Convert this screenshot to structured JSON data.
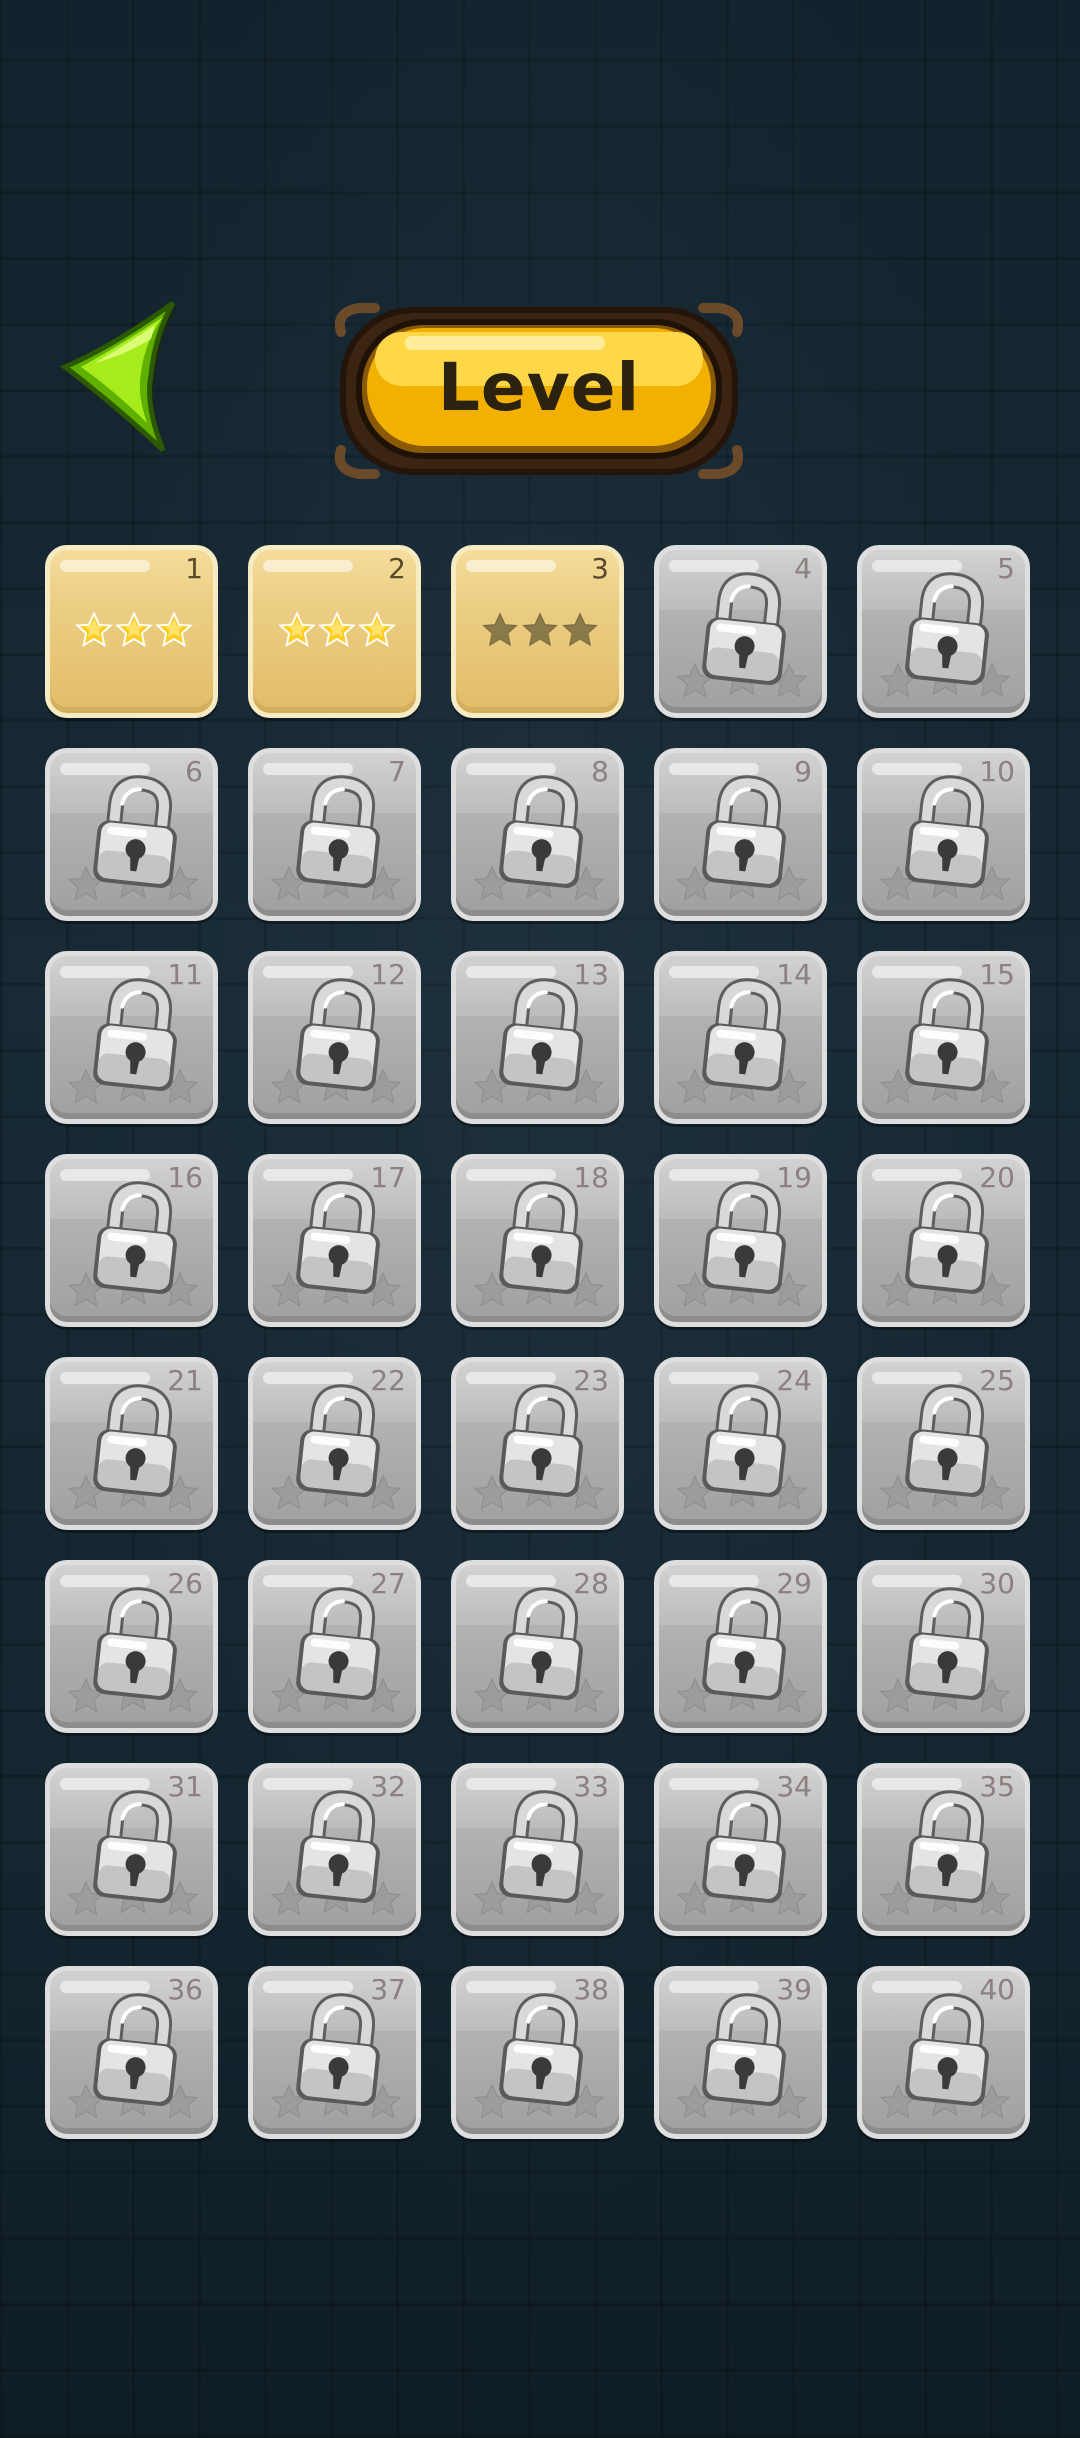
{
  "header": {
    "title": "Level",
    "back_icon": "back-arrow-icon"
  },
  "colors": {
    "arrow": "#8ee00a",
    "plaque_gold": "#f4b400",
    "tile_unlocked": "#eccf86",
    "tile_locked": "#bdbdbd",
    "star_gold": "#ffcc22",
    "star_empty": "#8a7a4a"
  },
  "levels": [
    {
      "number": "1",
      "locked": false,
      "stars": 3
    },
    {
      "number": "2",
      "locked": false,
      "stars": 3
    },
    {
      "number": "3",
      "locked": false,
      "stars": 0
    },
    {
      "number": "4",
      "locked": true,
      "stars": 0
    },
    {
      "number": "5",
      "locked": true,
      "stars": 0
    },
    {
      "number": "6",
      "locked": true,
      "stars": 0
    },
    {
      "number": "7",
      "locked": true,
      "stars": 0
    },
    {
      "number": "8",
      "locked": true,
      "stars": 0
    },
    {
      "number": "9",
      "locked": true,
      "stars": 0
    },
    {
      "number": "10",
      "locked": true,
      "stars": 0
    },
    {
      "number": "11",
      "locked": true,
      "stars": 0
    },
    {
      "number": "12",
      "locked": true,
      "stars": 0
    },
    {
      "number": "13",
      "locked": true,
      "stars": 0
    },
    {
      "number": "14",
      "locked": true,
      "stars": 0
    },
    {
      "number": "15",
      "locked": true,
      "stars": 0
    },
    {
      "number": "16",
      "locked": true,
      "stars": 0
    },
    {
      "number": "17",
      "locked": true,
      "stars": 0
    },
    {
      "number": "18",
      "locked": true,
      "stars": 0
    },
    {
      "number": "19",
      "locked": true,
      "stars": 0
    },
    {
      "number": "20",
      "locked": true,
      "stars": 0
    },
    {
      "number": "21",
      "locked": true,
      "stars": 0
    },
    {
      "number": "22",
      "locked": true,
      "stars": 0
    },
    {
      "number": "23",
      "locked": true,
      "stars": 0
    },
    {
      "number": "24",
      "locked": true,
      "stars": 0
    },
    {
      "number": "25",
      "locked": true,
      "stars": 0
    },
    {
      "number": "26",
      "locked": true,
      "stars": 0
    },
    {
      "number": "27",
      "locked": true,
      "stars": 0
    },
    {
      "number": "28",
      "locked": true,
      "stars": 0
    },
    {
      "number": "29",
      "locked": true,
      "stars": 0
    },
    {
      "number": "30",
      "locked": true,
      "stars": 0
    },
    {
      "number": "31",
      "locked": true,
      "stars": 0
    },
    {
      "number": "32",
      "locked": true,
      "stars": 0
    },
    {
      "number": "33",
      "locked": true,
      "stars": 0
    },
    {
      "number": "34",
      "locked": true,
      "stars": 0
    },
    {
      "number": "35",
      "locked": true,
      "stars": 0
    },
    {
      "number": "36",
      "locked": true,
      "stars": 0
    },
    {
      "number": "37",
      "locked": true,
      "stars": 0
    },
    {
      "number": "38",
      "locked": true,
      "stars": 0
    },
    {
      "number": "39",
      "locked": true,
      "stars": 0
    },
    {
      "number": "40",
      "locked": true,
      "stars": 0
    }
  ]
}
